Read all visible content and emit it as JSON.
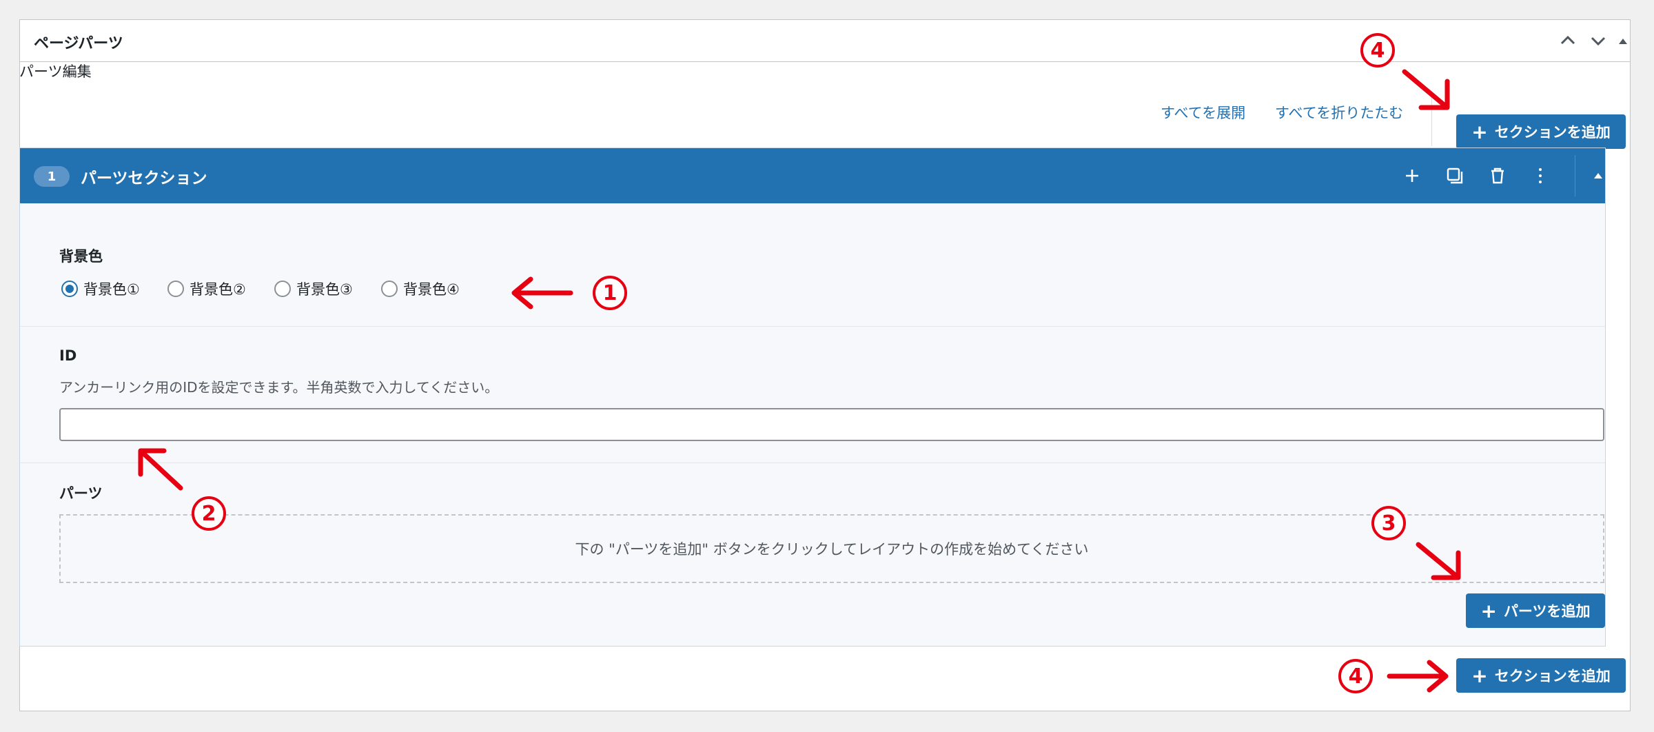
{
  "panel": {
    "title": "ページパーツ",
    "controls": {
      "up_icon": "chevron-up-icon",
      "down_icon": "chevron-down-icon",
      "toggle_icon": "triangle-up-icon"
    }
  },
  "editor": {
    "title": "パーツ編集",
    "expand_all": "すべてを展開",
    "collapse_all": "すべてを折りたたむ",
    "add_section_label": "セクションを追加"
  },
  "section": {
    "number": "1",
    "title": "パーツセクション",
    "icons": [
      "plus-icon",
      "duplicate-icon",
      "trash-icon",
      "more-vertical-icon",
      "triangle-up-icon"
    ],
    "bg_color": {
      "label": "背景色",
      "options": [
        "背景色①",
        "背景色②",
        "背景色③",
        "背景色④"
      ],
      "selected": "背景色①"
    },
    "id_field": {
      "label": "ID",
      "description": "アンカーリンク用のIDを設定できます。半角英数で入力してください。",
      "value": ""
    },
    "parts": {
      "label": "パーツ",
      "empty_message": "下の \"パーツを追加\" ボタンをクリックしてレイアウトの作成を始めてください",
      "add_parts_label": "パーツを追加"
    }
  },
  "annotations": {
    "marker_1": "1",
    "marker_2": "2",
    "marker_3": "3",
    "marker_4": "4",
    "color": "#e60012"
  },
  "colors": {
    "accent": "#2271b1",
    "annotation": "#e60012"
  }
}
